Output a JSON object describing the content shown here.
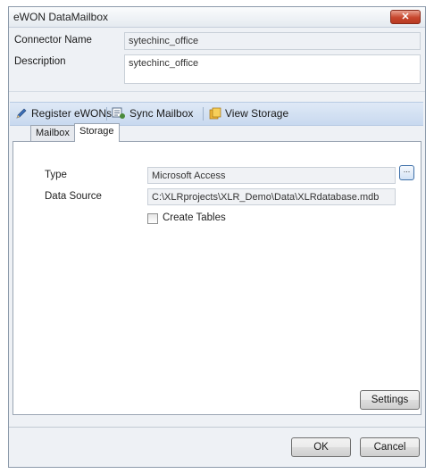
{
  "window": {
    "title": "eWON DataMailbox",
    "close_glyph": "✕"
  },
  "fields": {
    "connector_name": {
      "label": "Connector Name",
      "value": "sytechinc_office"
    },
    "description": {
      "label": "Description",
      "value": "sytechinc_office"
    }
  },
  "toolbar": {
    "register": {
      "label": "Register eWONs",
      "icon": "pencil-icon"
    },
    "sync": {
      "label": "Sync Mailbox",
      "icon": "sync-icon"
    },
    "view_storage": {
      "label": "View Storage",
      "icon": "storage-icon"
    }
  },
  "tabs": [
    {
      "label": "Mailbox",
      "active": false
    },
    {
      "label": "Storage",
      "active": true
    }
  ],
  "storage": {
    "type": {
      "label": "Type",
      "value": "Microsoft Access"
    },
    "data_source": {
      "label": "Data Source",
      "value": "C:\\XLRprojects\\XLR_Demo\\Data\\XLRdatabase.mdb"
    },
    "create_tables": {
      "label": "Create Tables",
      "checked": false
    },
    "browse_label": "...",
    "settings_label": "Settings"
  },
  "buttons": {
    "ok": "OK",
    "cancel": "Cancel"
  }
}
